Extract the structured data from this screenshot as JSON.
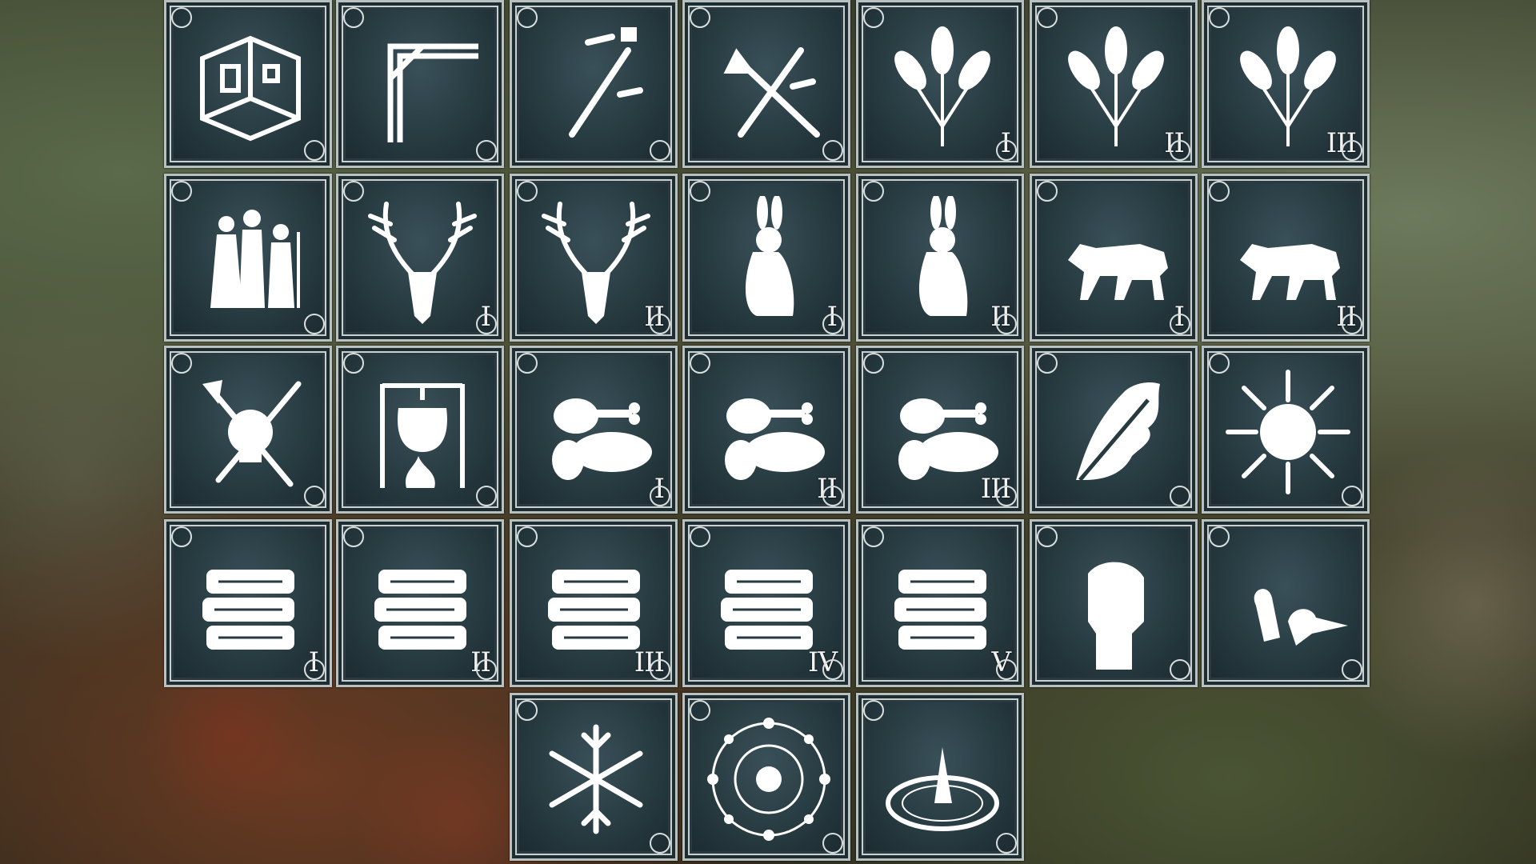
{
  "tiles": [
    {
      "icon": "room-icon",
      "tier": ""
    },
    {
      "icon": "beam-icon",
      "tier": ""
    },
    {
      "icon": "sword-tools-icon",
      "tier": ""
    },
    {
      "icon": "crossed-tools-icon",
      "tier": ""
    },
    {
      "icon": "wheat-icon",
      "tier": "I"
    },
    {
      "icon": "wheat-icon",
      "tier": "II"
    },
    {
      "icon": "wheat-icon",
      "tier": "III"
    },
    {
      "icon": "villagers-icon",
      "tier": ""
    },
    {
      "icon": "deer-skull-icon",
      "tier": "I"
    },
    {
      "icon": "deer-skull-icon",
      "tier": "II"
    },
    {
      "icon": "rabbit-icon",
      "tier": "I"
    },
    {
      "icon": "rabbit-icon",
      "tier": "II"
    },
    {
      "icon": "wolf-icon",
      "tier": "I"
    },
    {
      "icon": "wolf-icon",
      "tier": "II"
    },
    {
      "icon": "skull-weapons-icon",
      "tier": ""
    },
    {
      "icon": "cooking-pot-icon",
      "tier": ""
    },
    {
      "icon": "meat-bread-icon",
      "tier": "I"
    },
    {
      "icon": "meat-bread-icon",
      "tier": "II"
    },
    {
      "icon": "meat-bread-icon",
      "tier": "III"
    },
    {
      "icon": "oak-leaf-icon",
      "tier": ""
    },
    {
      "icon": "sun-icon",
      "tier": ""
    },
    {
      "icon": "books-icon",
      "tier": "I"
    },
    {
      "icon": "books-icon",
      "tier": "II"
    },
    {
      "icon": "books-icon",
      "tier": "III"
    },
    {
      "icon": "books-icon",
      "tier": "IV"
    },
    {
      "icon": "books-icon",
      "tier": "V"
    },
    {
      "icon": "fist-icon",
      "tier": ""
    },
    {
      "icon": "birds-icon",
      "tier": ""
    },
    {
      "icon": "snowflake-icon",
      "tier": ""
    },
    {
      "icon": "moon-phases-icon",
      "tier": ""
    },
    {
      "icon": "sundial-icon",
      "tier": ""
    }
  ],
  "colors": {
    "tile": "#263a40",
    "frame": "#c8d0d0",
    "icon": "#ffffff"
  }
}
